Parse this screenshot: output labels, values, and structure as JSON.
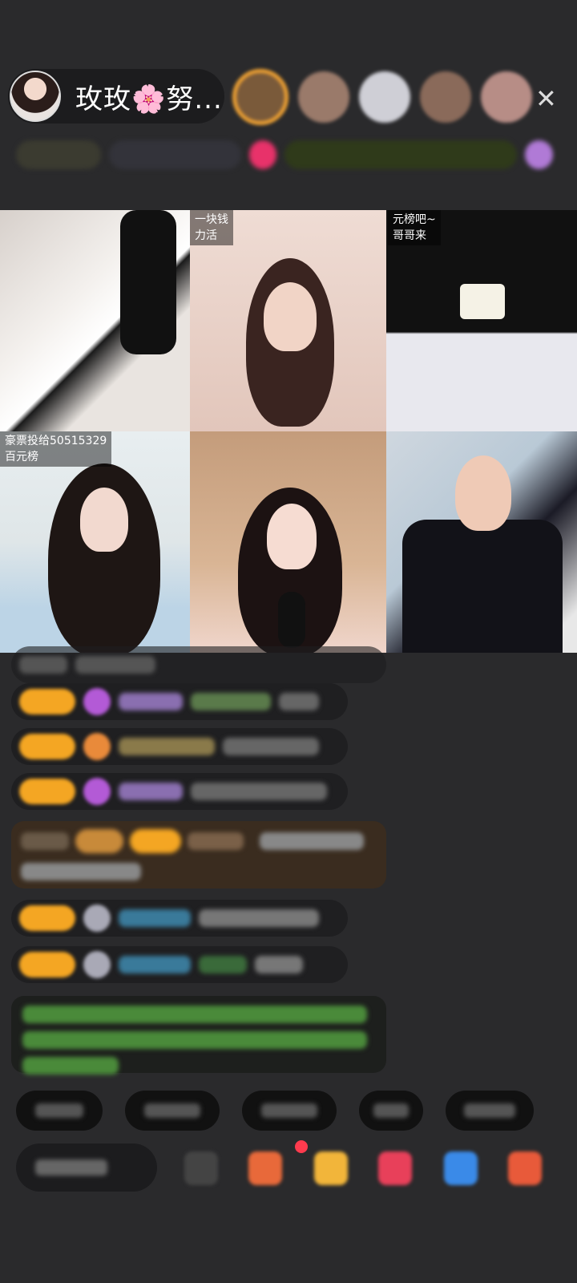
{
  "host": {
    "name": "玫玫🌸努..."
  },
  "top_bar": {
    "close_symbol": "✕"
  },
  "video_grid": {
    "cells": [
      {
        "caption": ""
      },
      {
        "caption_line1": "一块钱",
        "caption_line2": "力活"
      },
      {
        "caption_line1": "元榜吧~",
        "caption_line2": "哥哥来"
      },
      {
        "caption_line1": "豪票投给50515329",
        "caption_line2": "百元榜"
      },
      {
        "caption": ""
      },
      {
        "caption": ""
      }
    ]
  },
  "colors": {
    "background": "#2a2a2c",
    "level_badge": "#f4a623",
    "notification_dot": "#ff3b4e"
  }
}
